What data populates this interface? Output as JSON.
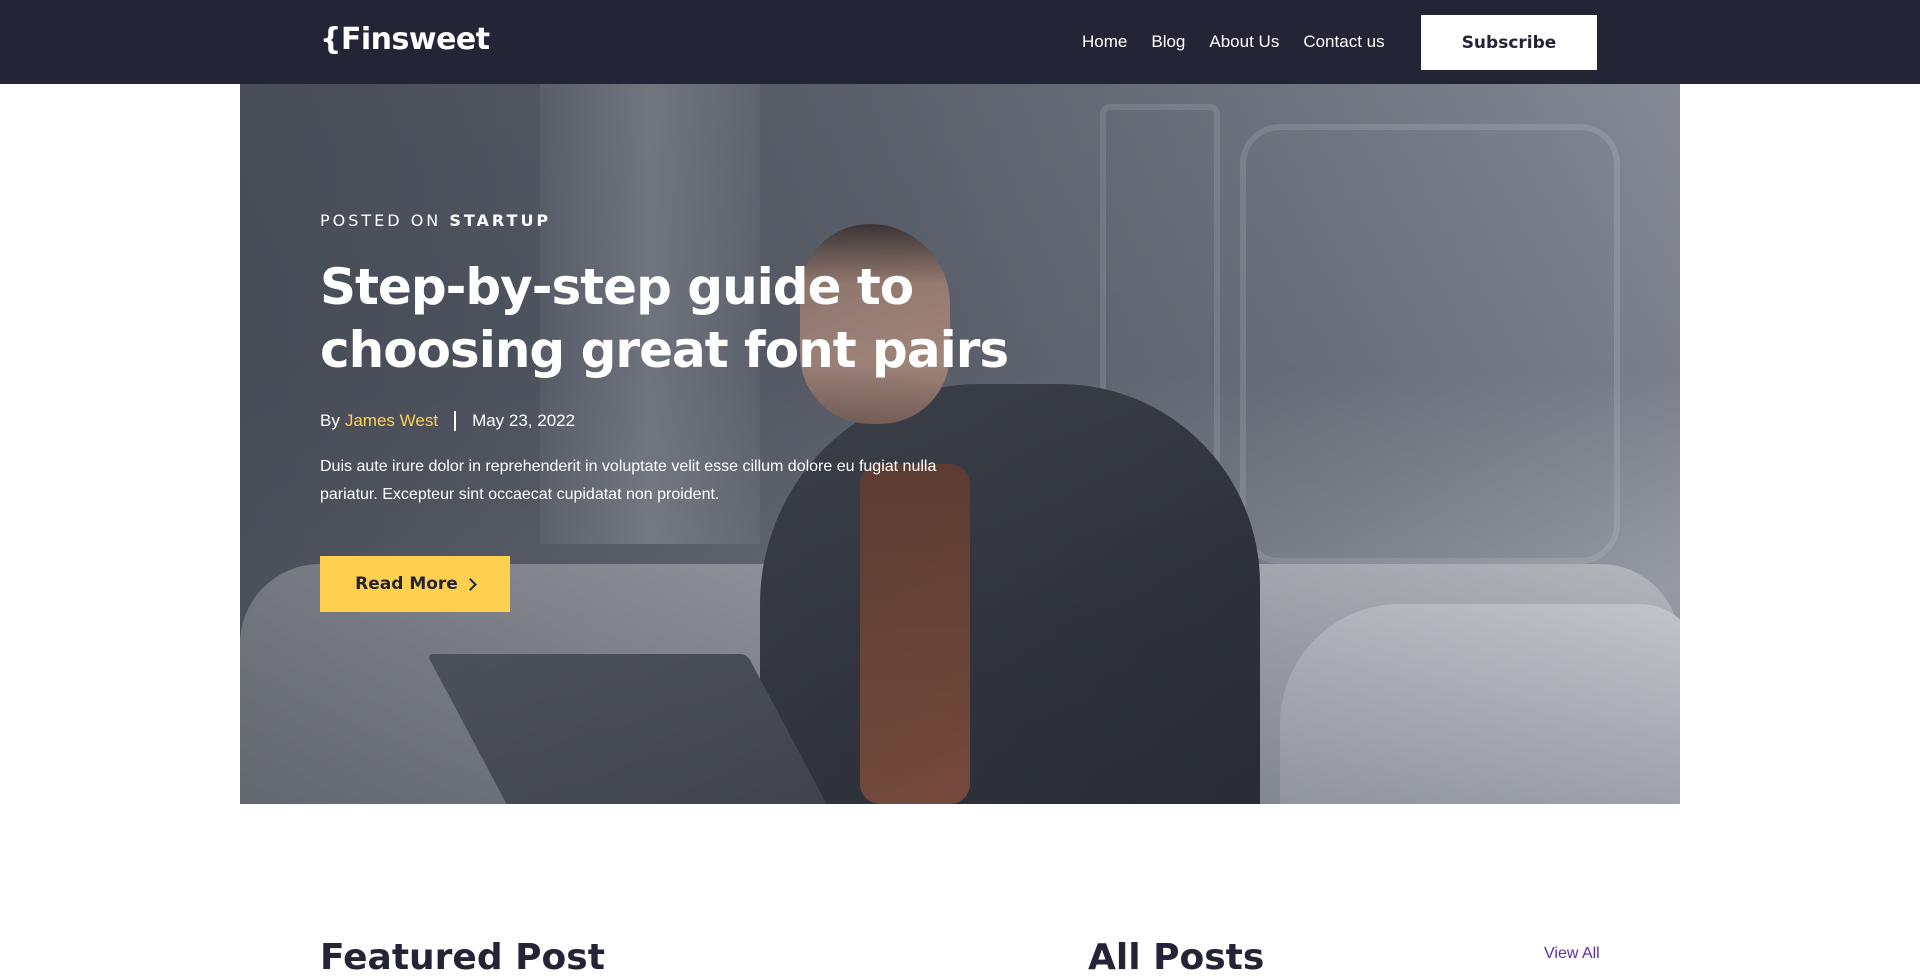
{
  "navbar": {
    "logo": "{Finsweet",
    "links": [
      "Home",
      "Blog",
      "About Us",
      "Contact us"
    ],
    "subscribe_label": "Subscribe"
  },
  "hero": {
    "posted_on_prefix": "POSTED ON",
    "category": "STARTUP",
    "title": "Step-by-step guide to choosing great font pairs",
    "by_label": "By",
    "author": "James West",
    "date": "May 23, 2022",
    "excerpt": "Duis aute irure dolor in reprehenderit in voluptate velit esse cillum dolore eu fugiat nulla pariatur. Excepteur sint occaecat cupidatat non proident.",
    "read_more_label": "Read More"
  },
  "featured": {
    "heading": "Featured Post"
  },
  "all_posts": {
    "heading": "All Posts",
    "view_all_label": "View All"
  },
  "colors": {
    "navbar_bg": "#232536",
    "accent_yellow": "#ffd050",
    "link_purple": "#592ea9",
    "text_dark": "#232536"
  },
  "icons": {
    "read_more_arrow": "chevron-right-icon"
  }
}
